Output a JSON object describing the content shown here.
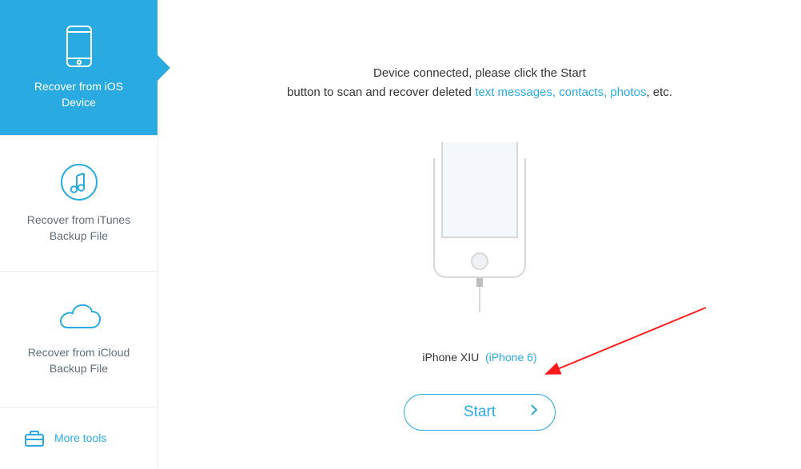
{
  "sidebar": {
    "items": [
      {
        "label": "Recover from iOS Device",
        "icon": "phone-icon"
      },
      {
        "label": "Recover from iTunes Backup File",
        "icon": "music-note-icon"
      },
      {
        "label": "Recover from iCloud Backup File",
        "icon": "cloud-icon"
      }
    ],
    "more_tools_label": "More tools",
    "more_tools_icon": "toolbox-icon"
  },
  "main": {
    "instruction_line1": "Device connected, please click the Start",
    "instruction_line2_prefix": "button to scan and recover deleted ",
    "instruction_highlight": "text messages, contacts, photos",
    "instruction_line2_suffix": ", etc.",
    "device_name": "iPhone XIU",
    "device_model": "(iPhone 6)",
    "start_label": "Start"
  },
  "colors": {
    "accent": "#29abe2"
  }
}
